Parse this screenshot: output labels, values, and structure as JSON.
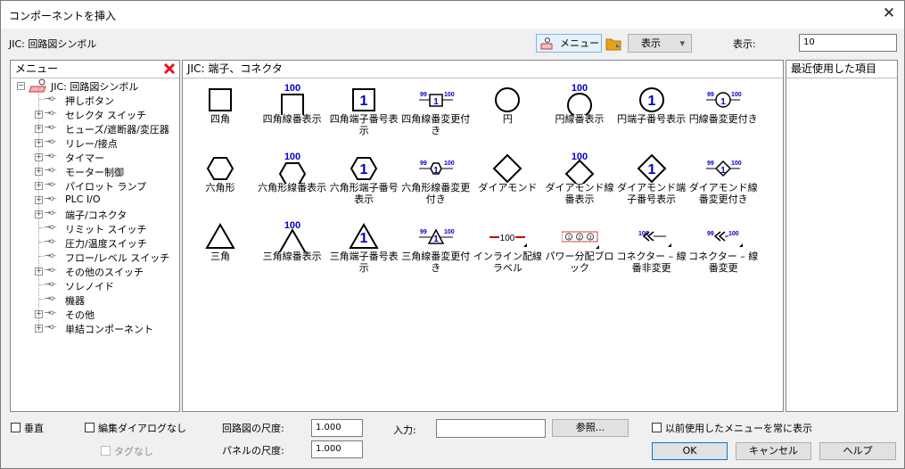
{
  "window": {
    "title": "コンポーネントを挿入",
    "close_glyph": "✕"
  },
  "toolbar": {
    "library_label": "JIC: 回路図シンボル",
    "menu_button_label": "メニュー",
    "view_button_label": "表示",
    "view_arrow": "▾",
    "display_label": "表示:",
    "display_value": "10"
  },
  "menu_panel": {
    "title": "メニュー",
    "root_label": "JIC: 回路図シンボル",
    "items": [
      {
        "label": "押しボタン",
        "expandable": false
      },
      {
        "label": "セレクタ スイッチ",
        "expandable": true
      },
      {
        "label": "ヒューズ/遮断器/変圧器",
        "expandable": true
      },
      {
        "label": "リレー/接点",
        "expandable": true
      },
      {
        "label": "タイマー",
        "expandable": true
      },
      {
        "label": "モーター制御",
        "expandable": true
      },
      {
        "label": "パイロット ランプ",
        "expandable": true
      },
      {
        "label": "PLC I/O",
        "expandable": true
      },
      {
        "label": "端子/コネクタ",
        "expandable": true
      },
      {
        "label": "リミット スイッチ",
        "expandable": false
      },
      {
        "label": "圧力/温度スイッチ",
        "expandable": false
      },
      {
        "label": "フロー/レベル スイッチ",
        "expandable": false
      },
      {
        "label": "その他のスイッチ",
        "expandable": true
      },
      {
        "label": "ソレノイド",
        "expandable": false
      },
      {
        "label": "機器",
        "expandable": false
      },
      {
        "label": "その他",
        "expandable": true
      },
      {
        "label": "単結コンポーネント",
        "expandable": true
      }
    ]
  },
  "symbol_panel": {
    "title": "JIC: 端子、コネクタ",
    "symbols": [
      {
        "caption": "四角",
        "shape": "square",
        "top": "",
        "inner": ""
      },
      {
        "caption": "四角線番表示",
        "shape": "square",
        "top": "100",
        "inner": ""
      },
      {
        "caption": "四角端子番号表示",
        "shape": "square",
        "top": "",
        "inner": "1"
      },
      {
        "caption": "四角線番変更付き",
        "shape": "square-change",
        "top": "",
        "inner": "1"
      },
      {
        "caption": "円",
        "shape": "circle",
        "top": "",
        "inner": ""
      },
      {
        "caption": "円線番表示",
        "shape": "circle",
        "top": "100",
        "inner": ""
      },
      {
        "caption": "円端子番号表示",
        "shape": "circle",
        "top": "",
        "inner": "1"
      },
      {
        "caption": "円線番変更付き",
        "shape": "circle-change",
        "top": "",
        "inner": "1"
      },
      {
        "caption": "六角形",
        "shape": "hexagon",
        "top": "",
        "inner": ""
      },
      {
        "caption": "六角形線番表示",
        "shape": "hexagon",
        "top": "100",
        "inner": ""
      },
      {
        "caption": "六角形端子番号表示",
        "shape": "hexagon",
        "top": "",
        "inner": "1"
      },
      {
        "caption": "六角形線番変更付き",
        "shape": "hexagon-change",
        "top": "",
        "inner": "1"
      },
      {
        "caption": "ダイアモンド",
        "shape": "diamond",
        "top": "",
        "inner": ""
      },
      {
        "caption": "ダイアモンド線番表示",
        "shape": "diamond",
        "top": "100",
        "inner": ""
      },
      {
        "caption": "ダイアモンド端子番号表示",
        "shape": "diamond",
        "top": "",
        "inner": "1"
      },
      {
        "caption": "ダイアモンド線番変更付き",
        "shape": "diamond-change",
        "top": "",
        "inner": "1"
      },
      {
        "caption": "三角",
        "shape": "triangle",
        "top": "",
        "inner": ""
      },
      {
        "caption": "三角線番表示",
        "shape": "triangle",
        "top": "100",
        "inner": ""
      },
      {
        "caption": "三角端子番号表示",
        "shape": "triangle",
        "top": "",
        "inner": "1"
      },
      {
        "caption": "三角線番変更付き",
        "shape": "triangle-change",
        "top": "",
        "inner": "1"
      },
      {
        "caption": "インライン配線ラベル",
        "shape": "inline-label",
        "top": "100",
        "inner": ""
      },
      {
        "caption": "パワー分配ブロック",
        "shape": "power-block",
        "top": "",
        "inner": "123"
      },
      {
        "caption": "コネクター – 線番非変更",
        "shape": "connector",
        "top": "100",
        "inner": ""
      },
      {
        "caption": "コネクター – 線番変更",
        "shape": "connector-change",
        "top": "",
        "inner": ""
      }
    ],
    "change_labels": {
      "left": "99",
      "right": "100"
    },
    "power_block_labels": [
      "1",
      "2",
      "3"
    ]
  },
  "recent_panel": {
    "title": "最近使用した項目"
  },
  "bottom": {
    "vertical_label": "垂直",
    "no_edit_dialog_label": "編集ダイアログなし",
    "no_tag_label": "タグなし",
    "schematic_scale_label": "回路図の尺度:",
    "schematic_scale_value": "1.000",
    "panel_scale_label": "パネルの尺度:",
    "panel_scale_value": "1.000",
    "input_label": "入力:",
    "input_value": "",
    "browse_label": "参照...",
    "always_show_label": "以前使用したメニューを常に表示",
    "ok_label": "OK",
    "cancel_label": "キャンセル",
    "help_label": "ヘルプ"
  },
  "colors": {
    "accent_blue": "#0000cc",
    "red_x": "#e81123",
    "inline_red": "#cc0000",
    "power_red": "#d04040",
    "folder": "#e8a317"
  }
}
